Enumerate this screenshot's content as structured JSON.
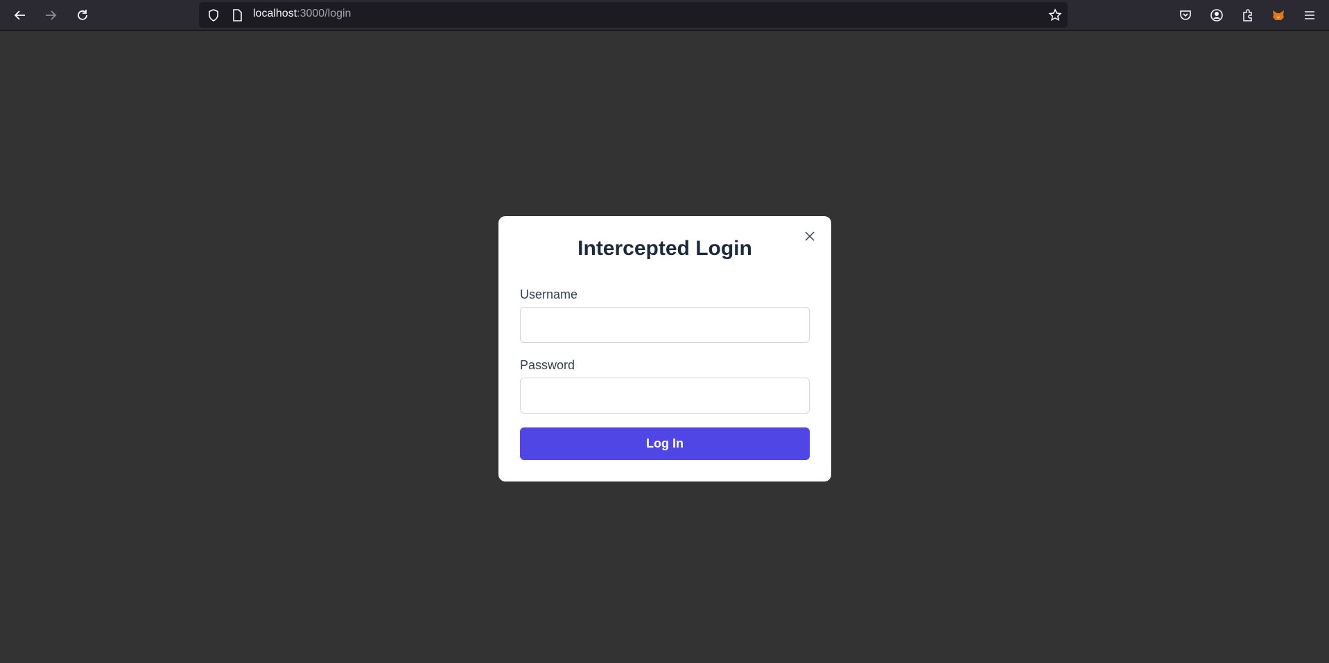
{
  "browser": {
    "url_host": "localhost",
    "url_path": ":3000/login",
    "icons": {
      "back": "arrow-left",
      "forward": "arrow-right",
      "reload": "reload",
      "tracking": "shield",
      "page": "document",
      "bookmark": "star",
      "pocket": "pocket",
      "account": "account-circle",
      "extensions": "puzzle-piece",
      "metamask": "fox",
      "menu": "hamburger"
    }
  },
  "modal": {
    "title": "Intercepted Login",
    "username_label": "Username",
    "username_value": "",
    "password_label": "Password",
    "password_value": "",
    "submit_label": "Log In",
    "accent_color": "#4f46e5"
  }
}
